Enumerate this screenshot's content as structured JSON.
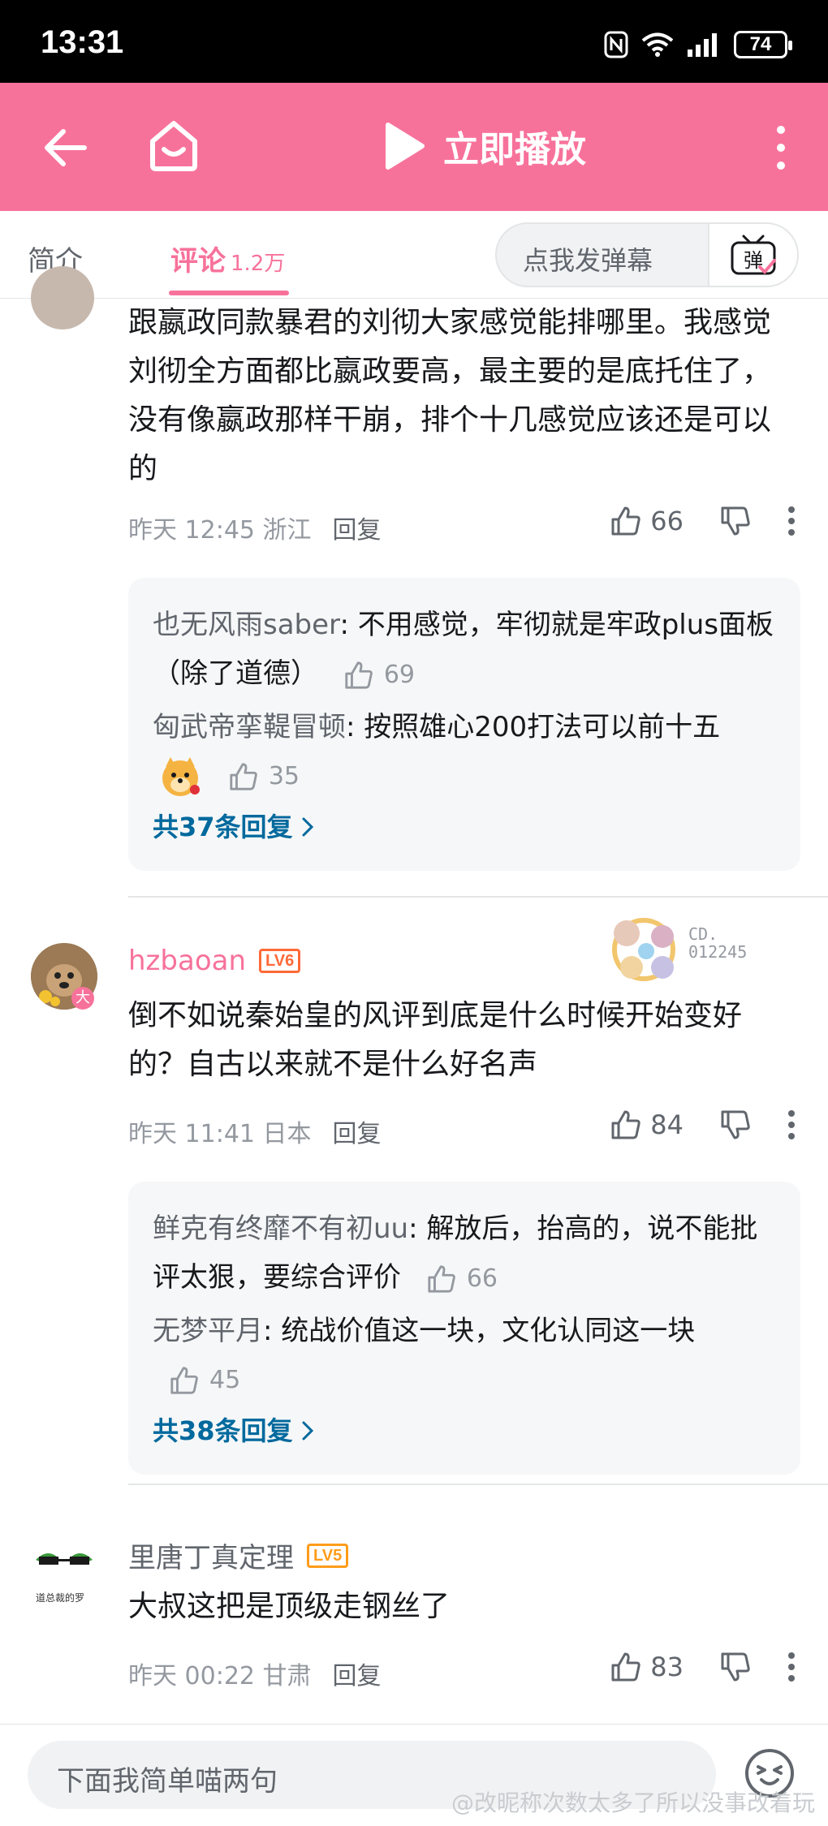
{
  "status_bar": {
    "time": "13:31",
    "battery": "74"
  },
  "header": {
    "play_label": "立即播放"
  },
  "tabs": {
    "intro": "简介",
    "comments": "评论",
    "comment_count": "1.2万",
    "danmu_placeholder": "点我发弹幕",
    "danmu_button": "弹"
  },
  "comments": [
    {
      "text": "跟嬴政同款暴君的刘彻大家感觉能排哪里。我感觉刘彻全方面都比嬴政要高，最主要的是底托住了，没有像嬴政那样干崩，排个十几感觉应该还是可以的",
      "time": "昨天 12:45",
      "location": "浙江",
      "reply": "回复",
      "likes": "66",
      "replies": [
        {
          "user": "也无风雨saber",
          "text": "不用感觉，牢彻就是牢政plus面板（除了道德）",
          "likes": "69"
        },
        {
          "user": "匈武帝挛鞮冒顿",
          "text": "按照雄心200打法可以前十五",
          "likes": "35"
        }
      ],
      "more_replies": "共37条回复"
    },
    {
      "user": "hzbaoan",
      "level": "LV6",
      "badge_text": "CD.\n012245",
      "text": "倒不如说秦始皇的风评到底是什么时候开始变好的？自古以来就不是什么好名声",
      "time": "昨天 11:41",
      "location": "日本",
      "reply": "回复",
      "likes": "84",
      "replies": [
        {
          "user": "鲜克有终靡不有初uu",
          "text": "解放后，抬高的，说不能批评太狠，要综合评价",
          "likes": "66"
        },
        {
          "user": "无梦平月",
          "text": "统战价值这一块，文化认同这一块",
          "likes": "45"
        }
      ],
      "more_replies": "共38条回复"
    },
    {
      "user": "里唐丁真定理",
      "level": "LV5",
      "avatar_caption": "道总裁的罗",
      "text": "大叔这把是顶级走钢丝了",
      "time": "昨天 00:22",
      "location": "甘肃",
      "reply": "回复",
      "likes": "83"
    }
  ],
  "bottom": {
    "input_placeholder": "下面我简单喵两句",
    "watermark": "@改昵称次数太多了所以没事改着玩"
  },
  "colors": {
    "brand_pink": "#f7729b",
    "link_blue": "#00699d",
    "level_orange": "#ff6a39",
    "muted": "#9499a0"
  }
}
